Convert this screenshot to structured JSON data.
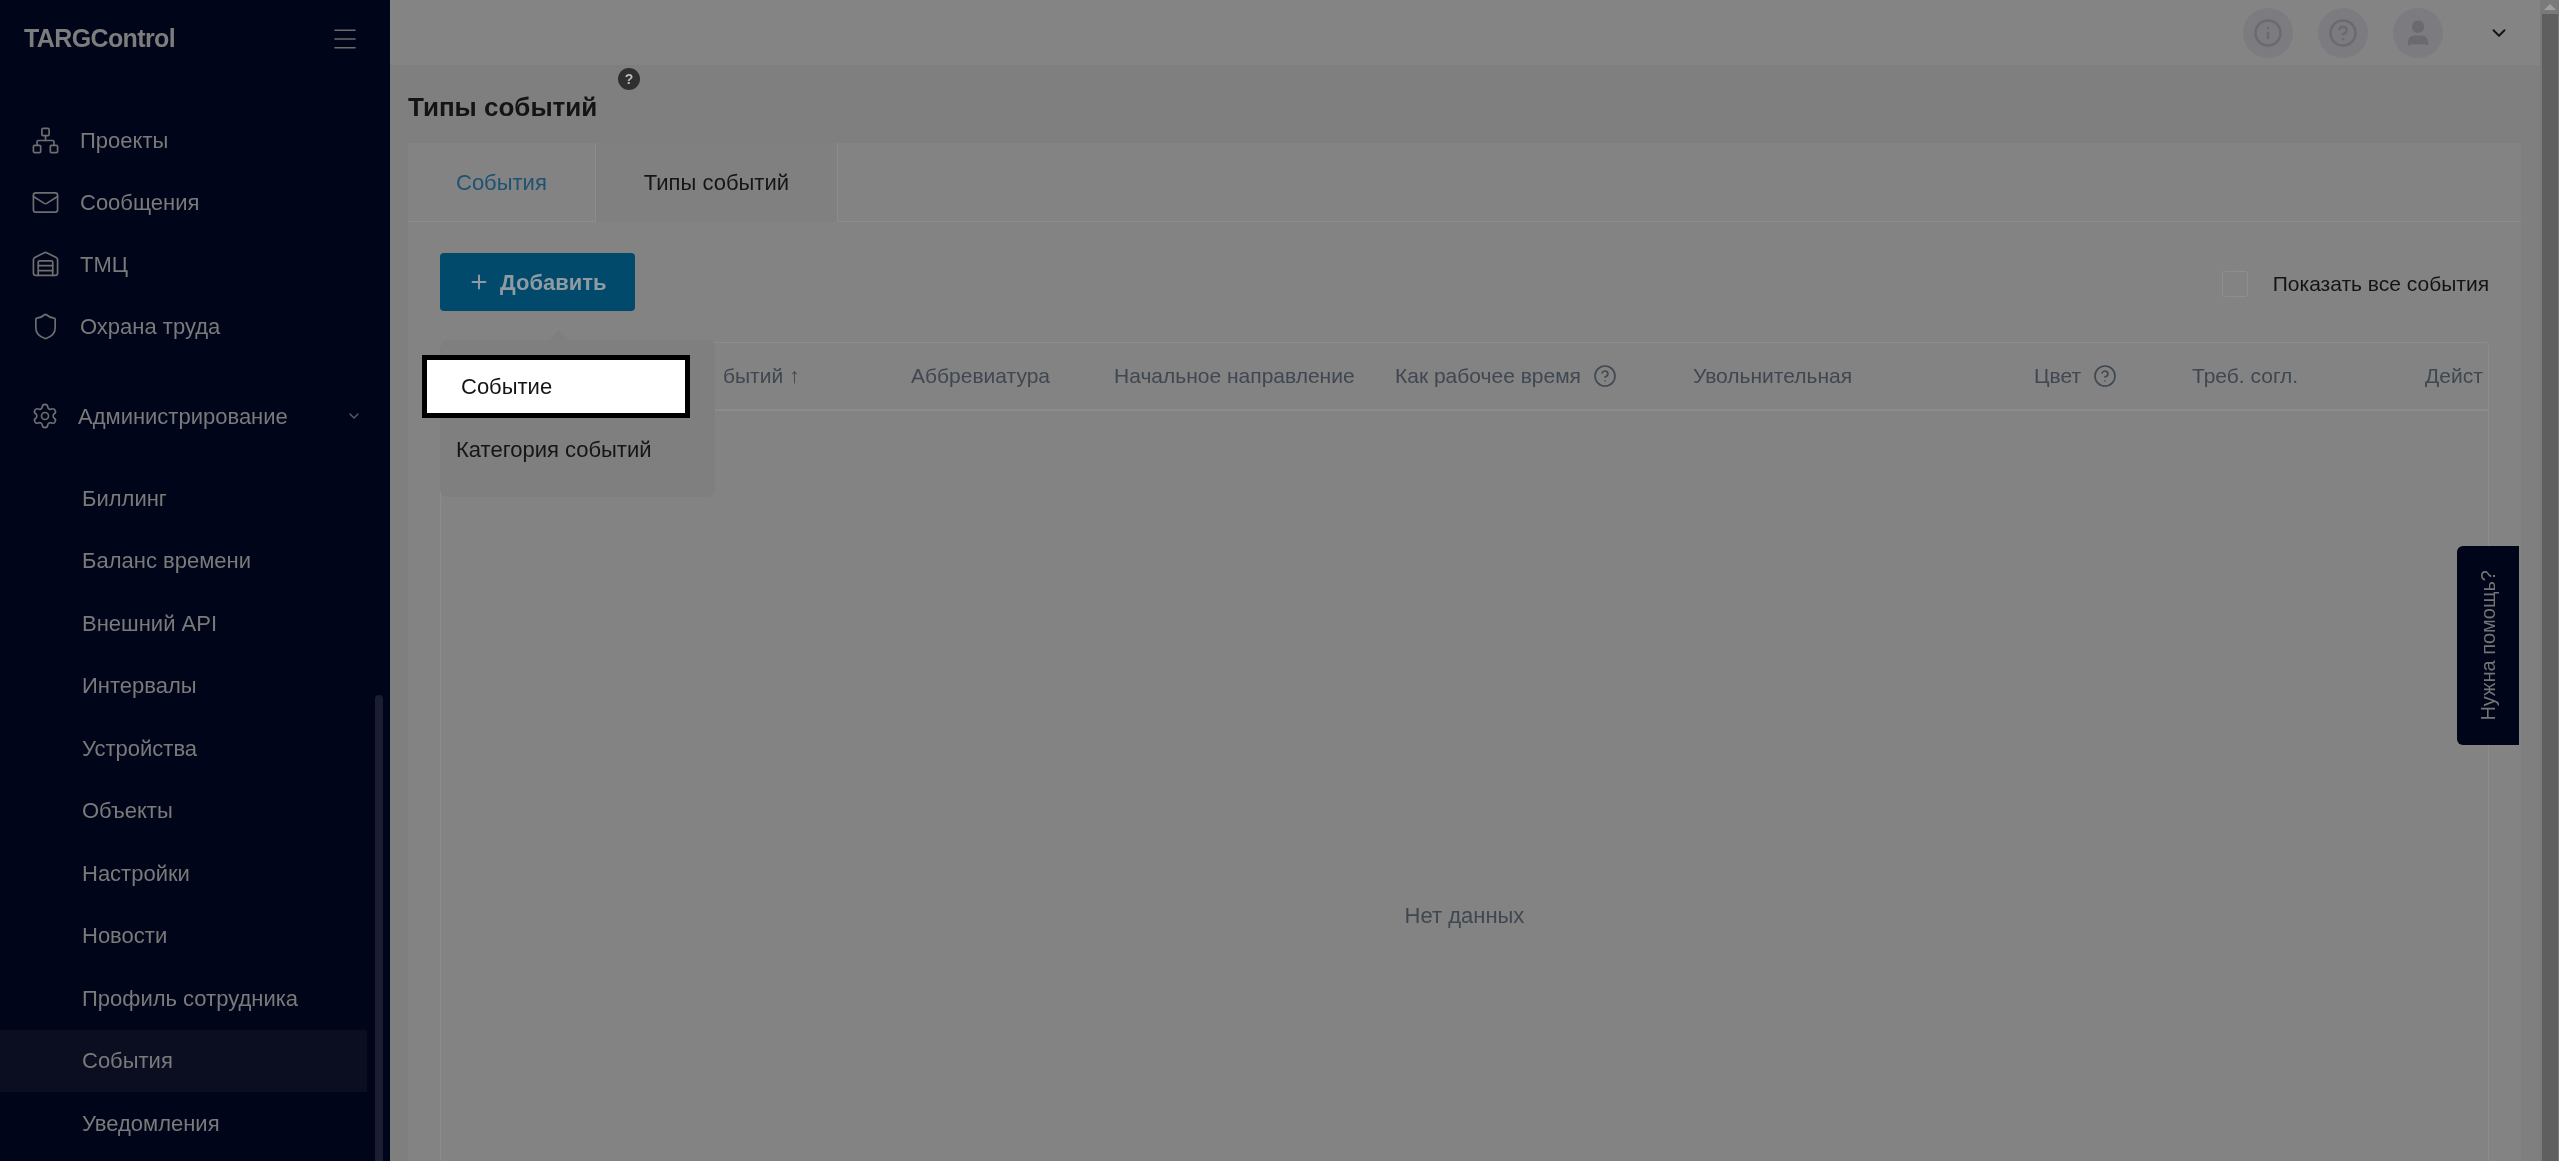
{
  "logo": "TARGControl",
  "sidebar": {
    "items": [
      {
        "label": "Проекты"
      },
      {
        "label": "Сообщения"
      },
      {
        "label": "ТМЦ"
      },
      {
        "label": "Охрана труда"
      }
    ],
    "admin": {
      "label": "Администрирование",
      "expanded": true,
      "children": [
        {
          "label": "Биллинг",
          "selected": false
        },
        {
          "label": "Баланс времени",
          "selected": false
        },
        {
          "label": "Внешний API",
          "selected": false
        },
        {
          "label": "Интервалы",
          "selected": false
        },
        {
          "label": "Устройства",
          "selected": false
        },
        {
          "label": "Объекты",
          "selected": false
        },
        {
          "label": "Настройки",
          "selected": false
        },
        {
          "label": "Новости",
          "selected": false
        },
        {
          "label": "Профиль сотрудника",
          "selected": false
        },
        {
          "label": "События",
          "selected": true
        },
        {
          "label": "Уведомления",
          "selected": false
        }
      ]
    }
  },
  "page": {
    "title": "Типы событий",
    "help_badge": "?"
  },
  "tabs": [
    {
      "label": "События",
      "selected": false
    },
    {
      "label": "Типы событий",
      "selected": true
    }
  ],
  "add_button": {
    "label": "Добавить"
  },
  "add_menu": [
    {
      "label": "Событие",
      "selected": true
    },
    {
      "label": "Категория событий",
      "selected": false
    }
  ],
  "show_all": {
    "label": "Показать все события",
    "checked": false
  },
  "table": {
    "columns": [
      {
        "label": "бытий ↑",
        "help": false
      },
      {
        "label": "Аббревиатура",
        "help": false
      },
      {
        "label": "Начальное направление",
        "help": false
      },
      {
        "label": "Как рабочее время",
        "help": true
      },
      {
        "label": "Увольнительная",
        "help": false
      },
      {
        "label": "Цвет",
        "help": true
      },
      {
        "label": "Треб. согл.",
        "help": false
      },
      {
        "label": "Дейст"
      }
    ],
    "empty_text": "Нет данных"
  },
  "help_tab": {
    "label": "Нужна помощь?"
  }
}
